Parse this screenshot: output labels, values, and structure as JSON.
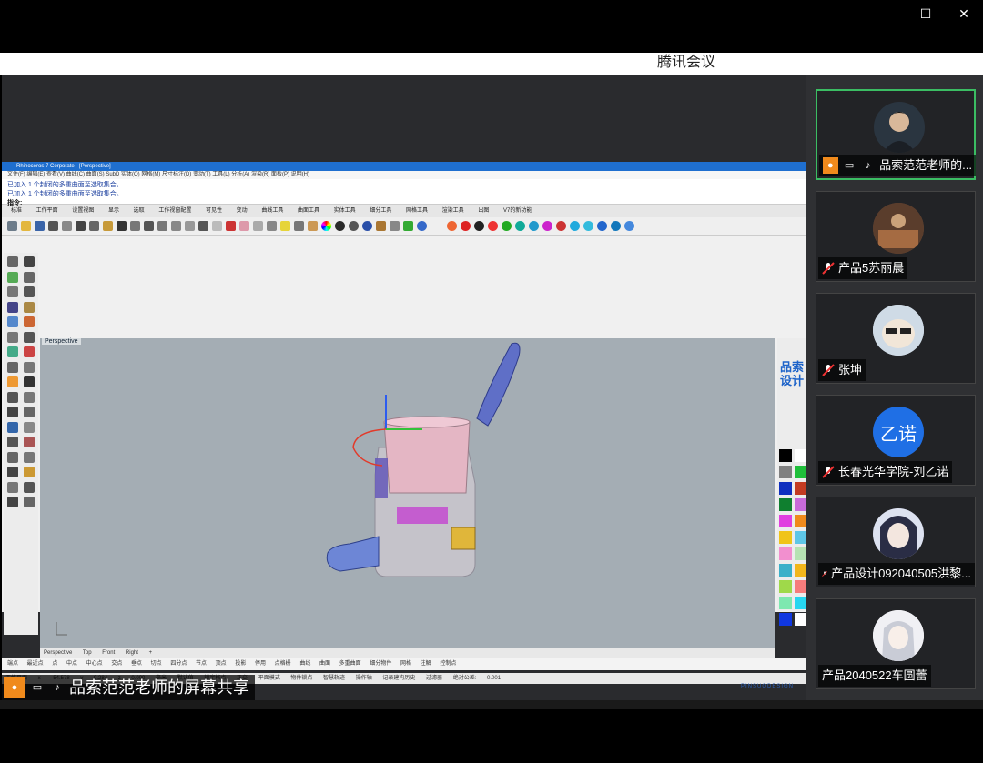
{
  "window": {
    "title": "腾讯会议",
    "controls": {
      "minimize": "—",
      "maximize": "☐",
      "close": "✕"
    }
  },
  "share_banner": {
    "label": "品索范范老师的屏幕共享"
  },
  "participants": [
    {
      "name": "品索范范老师的...",
      "active": true,
      "avatar": "photo-man"
    },
    {
      "name": "产品5苏丽晨",
      "active": false,
      "avatar": "photo-room"
    },
    {
      "name": "张坤",
      "active": false,
      "avatar": "photo-dog"
    },
    {
      "name": "长春光华学院-刘乙诺",
      "active": false,
      "avatar": "initials",
      "initials": "乙诺",
      "avatar_color": "#1f6fe5"
    },
    {
      "name": "产品设计092040505洪黎...",
      "active": false,
      "avatar": "photo-anime"
    },
    {
      "name": "产品2040522车圆蕾",
      "active": false,
      "avatar": "photo-girl"
    }
  ],
  "rhino": {
    "title": "Rhinoceros 7 Corporate - [Perspective]",
    "menu": "文件(F)  编辑(E)  查看(V)  曲线(C)  曲面(S)  SubD  实体(O)  网格(M)  尺寸标注(D)  变动(T)  工具(L)  分析(A)  渲染(R)  面板(P)  说明(H)",
    "command_history": [
      "已加入 1 个封闭的多重曲面至选取集合。",
      "已加入 1 个封闭的多重曲面至选取集合。"
    ],
    "command_prompt": "指令:",
    "tabs": "标准 工作平面 设置视图 显示 选取 工作视窗配置 可见性 变动 曲线工具 曲面工具 实体工具 细分工具 网格工具 渲染工具 出图 V7的新功能",
    "viewport_label": "Perspective",
    "viewport_tabs": "Perspective Top Front Right +",
    "osnaps": "端点 最近点 点 中点 中心点 交点 垂点 切点 四分点 节点 顶点 投影 停用 点格栅 曲线 曲面 多重曲面 细分物件 网格 注解 控制点",
    "status": "工作平面 x -54.578 y 9.284 z 0.000 毫米 默认值 锁定格点 正交 平面模式 物件锁点 智慧轨迹 操作轴 记录建构历史 过滤器 绝对公差: 0.001",
    "brand_logo": "品索设计",
    "brand_text": "PINSUODESIGN",
    "swatch_colors": [
      "#000000",
      "#ffffff",
      "#808080",
      "#1fbf3a",
      "#0f2fbf",
      "#c23b22",
      "#0f7f2f",
      "#c86bd9",
      "#e03fe0",
      "#f08a1c",
      "#f0c419",
      "#5ec6e6",
      "#f28fcf",
      "#b6e2b3",
      "#3bb0c9",
      "#f2b61b",
      "#9fd94a",
      "#f57c7c",
      "#7ee8b0",
      "#27d6f0",
      "#1037e0",
      "#ffffff"
    ]
  }
}
